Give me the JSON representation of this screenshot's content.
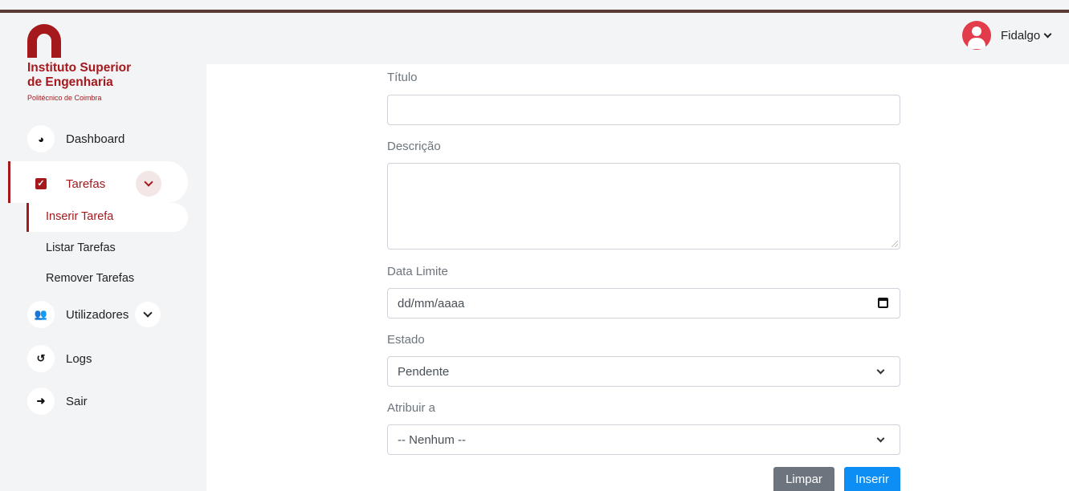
{
  "brand": {
    "name_line1": "Instituto Superior",
    "name_line2": "de Engenharia",
    "subtitle": "Politécnico de Coimbra",
    "color": "#a5181c"
  },
  "user": {
    "name": "Fidalgo",
    "avatar_icon": "user-icon"
  },
  "nav": {
    "dashboard": "Dashboard",
    "tarefas": "Tarefas",
    "tarefas_sub": {
      "inserir": "Inserir Tarefa",
      "listar": "Listar Tarefas",
      "remover": "Remover Tarefas"
    },
    "utilizadores": "Utilizadores",
    "logs": "Logs",
    "sair": "Sair"
  },
  "form": {
    "titulo_label": "Título",
    "titulo_value": "",
    "descricao_label": "Descrição",
    "descricao_value": "",
    "data_label": "Data Limite",
    "data_placeholder": "dd/mm/aaaa",
    "estado_label": "Estado",
    "estado_selected": "Pendente",
    "atribuir_label": "Atribuir a",
    "atribuir_selected": "-- Nenhum --",
    "clear_button": "Limpar",
    "insert_button": "Inserir"
  },
  "colors": {
    "accent": "#a5181c",
    "primary_button": "#0d8ef5",
    "secondary_button": "#6c757d"
  }
}
